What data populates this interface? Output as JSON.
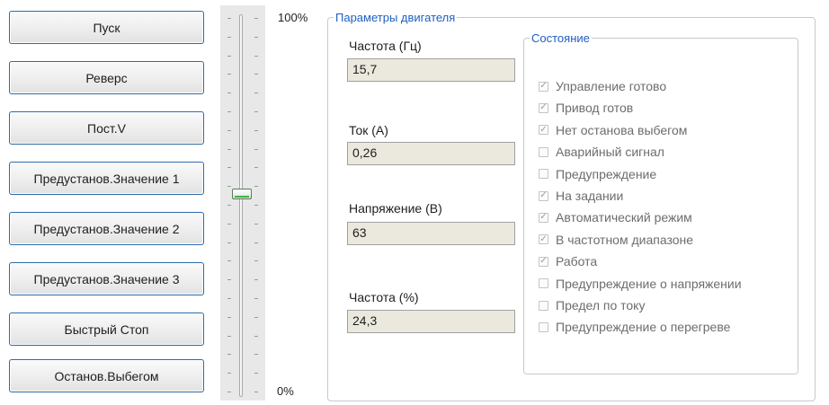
{
  "buttons": [
    {
      "label": "Пуск"
    },
    {
      "label": "Реверс"
    },
    {
      "label": "Пост.V"
    },
    {
      "label": "Предустанов.Значение 1"
    },
    {
      "label": "Предустанов.Значение 2"
    },
    {
      "label": "Предустанов.Значение 3"
    },
    {
      "label": "Быстрый Стоп"
    },
    {
      "label": "Останов.Выбегом"
    }
  ],
  "slider": {
    "max_label": "100%",
    "min_label": "0%",
    "level": 0.53
  },
  "motor_params": {
    "title": "Параметры двигателя",
    "fields": [
      {
        "label": "Частота (Гц)",
        "value": "15,7"
      },
      {
        "label": "Ток (A)",
        "value": "0,26"
      },
      {
        "label": "Напряжение (В)",
        "value": "63"
      },
      {
        "label": "Частота (%)",
        "value": "24,3"
      }
    ]
  },
  "status": {
    "title": "Состояние",
    "items": [
      {
        "label": "Управление готово",
        "checked": true
      },
      {
        "label": "Привод готов",
        "checked": true
      },
      {
        "label": "Нет останова выбегом",
        "checked": true
      },
      {
        "label": "Аварийный сигнал",
        "checked": false
      },
      {
        "label": "Предупреждение",
        "checked": false
      },
      {
        "label": "На задании",
        "checked": true
      },
      {
        "label": "Автоматический режим",
        "checked": true
      },
      {
        "label": "В частотном диапазоне",
        "checked": true
      },
      {
        "label": "Работа",
        "checked": true
      },
      {
        "label": "Предупреждение о напряжении",
        "checked": false
      },
      {
        "label": "Предел по току",
        "checked": false
      },
      {
        "label": "Предупреждение о перегреве",
        "checked": false
      }
    ]
  }
}
